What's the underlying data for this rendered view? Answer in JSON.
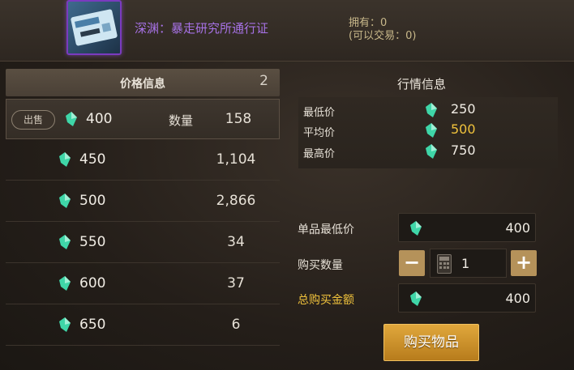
{
  "item": {
    "name": "深渊：暴走研究所通行证",
    "icon": "pass-card-icon",
    "owned": "拥有：0",
    "tradable": "(可以交易：0)"
  },
  "listing": {
    "title": "价格信息",
    "page": "2",
    "sell_label": "出售",
    "qty_header": "数量",
    "rows": [
      {
        "price": "400",
        "qty": "158"
      },
      {
        "price": "450",
        "qty": "1,104"
      },
      {
        "price": "500",
        "qty": "2,866"
      },
      {
        "price": "550",
        "qty": "34"
      },
      {
        "price": "600",
        "qty": "37"
      },
      {
        "price": "650",
        "qty": "6"
      }
    ]
  },
  "market": {
    "title": "行情信息",
    "min_label": "最低价",
    "min_value": "250",
    "avg_label": "平均价",
    "avg_value": "500",
    "max_label": "最高价",
    "max_value": "750"
  },
  "purchase": {
    "unit_label": "单品最低价",
    "unit_value": "400",
    "qty_label": "购买数量",
    "qty_value": "1",
    "minus": "−",
    "plus": "+",
    "total_label": "总购买金额",
    "total_value": "400",
    "buy_button": "购买物品"
  },
  "colors": {
    "gold": "#f0c23c",
    "purple": "#a772e6",
    "gem": "#3fd6a8"
  }
}
